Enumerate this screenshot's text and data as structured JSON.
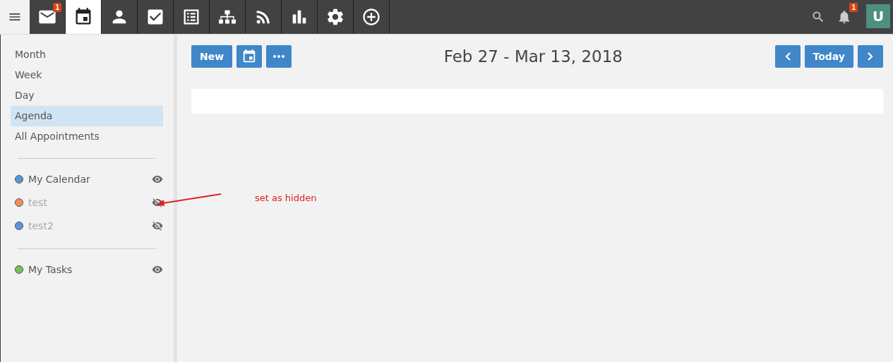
{
  "menu_button": {
    "kind": "menu"
  },
  "nav_tabs": [
    {
      "kind": "mail",
      "selected": false,
      "badge": "1"
    },
    {
      "kind": "calendar",
      "selected": true
    },
    {
      "kind": "contacts",
      "selected": false
    },
    {
      "kind": "tasks",
      "selected": false
    },
    {
      "kind": "documents",
      "selected": false
    },
    {
      "kind": "hierarchy",
      "selected": false
    },
    {
      "kind": "feed",
      "selected": false
    },
    {
      "kind": "charts",
      "selected": false
    },
    {
      "kind": "settings",
      "selected": false
    },
    {
      "kind": "add",
      "selected": false
    }
  ],
  "top_right": {
    "notifications_badge": "1",
    "avatar": "U"
  },
  "views": [
    {
      "label": "Month",
      "selected": false
    },
    {
      "label": "Week",
      "selected": false
    },
    {
      "label": "Day",
      "selected": false
    },
    {
      "label": "Agenda",
      "selected": true
    },
    {
      "label": "All Appointments",
      "selected": false
    }
  ],
  "calendar_groups": [
    [
      {
        "name": "My Calendar",
        "color": "#5b95d5",
        "visible": true
      },
      {
        "name": "test",
        "color": "#ef9060",
        "visible": false
      },
      {
        "name": "test2",
        "color": "#5b95d5",
        "visible": false
      }
    ],
    [
      {
        "name": "My Tasks",
        "color": "#7cbd5c",
        "visible": true
      }
    ]
  ],
  "toolbar": {
    "new_button": "New",
    "today_button": "Today",
    "date_range": "Feb 27 - Mar 13, 2018"
  },
  "annotation": {
    "text": "set as hidden"
  }
}
